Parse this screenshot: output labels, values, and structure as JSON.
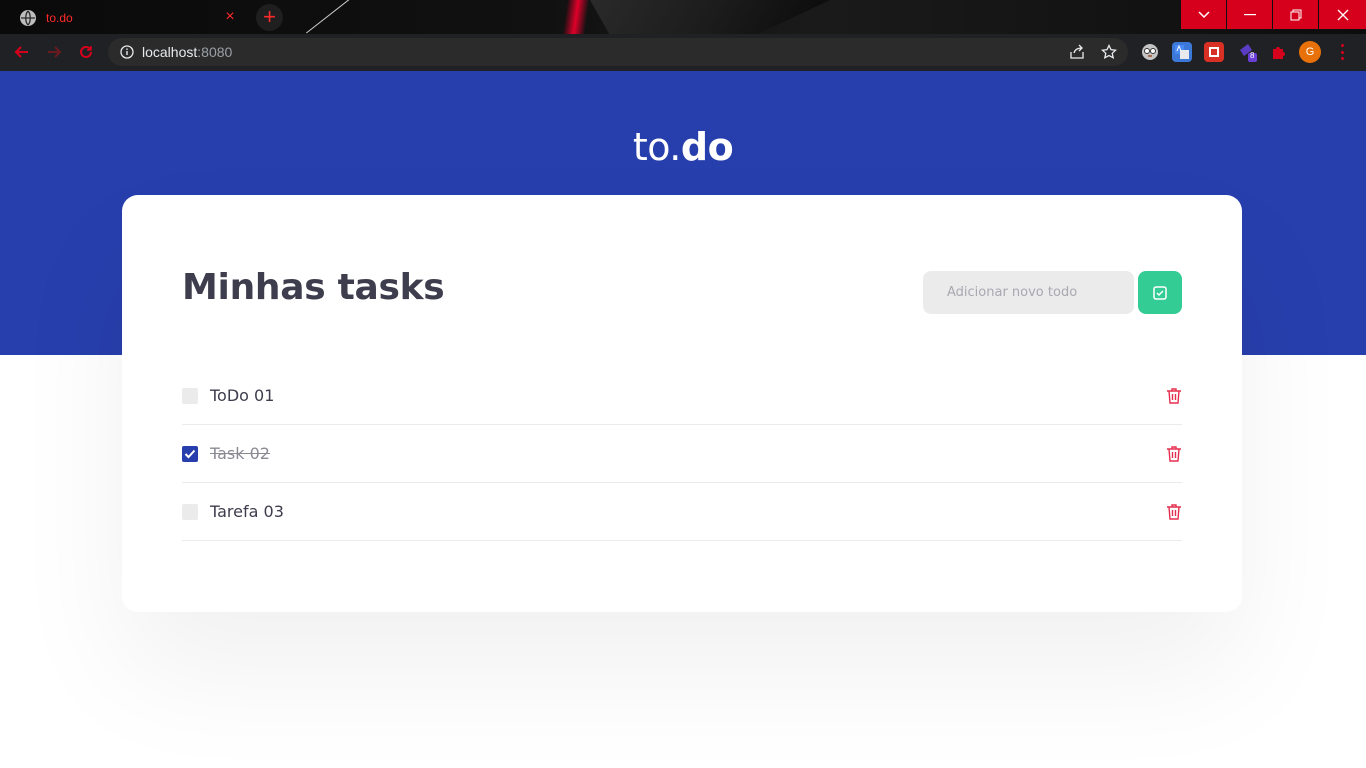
{
  "browser": {
    "tab_title": "to.do",
    "tab_close_glyph": "×",
    "new_tab_glyph": "+",
    "url_host": "localhost",
    "url_port": ":8080",
    "profile_initial": "G",
    "extension_badge": "8",
    "accent_color": "#d6001c"
  },
  "app": {
    "brand_light": "to.",
    "brand_bold": "do",
    "heading": "Minhas tasks",
    "input_placeholder": "Adicionar novo todo",
    "colors": {
      "header_bg": "#273fad",
      "add_button": "#33cc95",
      "trash": "#e52e4d",
      "checkbox_checked": "#273fad"
    },
    "tasks": [
      {
        "title": "ToDo 01",
        "completed": false
      },
      {
        "title": "Task 02",
        "completed": true
      },
      {
        "title": "Tarefa 03",
        "completed": false
      }
    ]
  }
}
